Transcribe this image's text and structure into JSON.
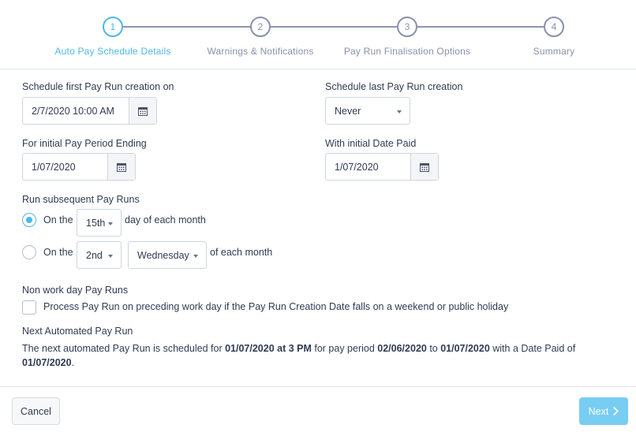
{
  "wizard": {
    "steps": [
      {
        "number": "1",
        "label": "Auto Pay Schedule Details"
      },
      {
        "number": "2",
        "label": "Warnings & Notifications"
      },
      {
        "number": "3",
        "label": "Pay Run Finalisation Options"
      },
      {
        "number": "4",
        "label": "Summary"
      }
    ],
    "active_step": 1
  },
  "form": {
    "first_creation": {
      "label": "Schedule first Pay Run creation on",
      "value": "2/7/2020 10:00 AM",
      "icon": "calendar-icon"
    },
    "last_creation": {
      "label": "Schedule last Pay Run creation",
      "value": "Never"
    },
    "initial_period_ending": {
      "label": "For initial Pay Period Ending",
      "value": "1/07/2020",
      "icon": "calendar-icon"
    },
    "initial_date_paid": {
      "label": "With initial Date Paid",
      "value": "1/07/2020",
      "icon": "calendar-icon"
    },
    "subsequent": {
      "label": "Run subsequent Pay Runs",
      "option1": {
        "prefix": "On the",
        "day": "15th",
        "suffix": "day of each month",
        "checked": true
      },
      "option2": {
        "prefix": "On the",
        "ordinal": "2nd",
        "weekday": "Wednesday",
        "suffix": "of each month",
        "checked": false
      }
    },
    "non_work_day": {
      "label": "Non work day Pay Runs",
      "checkbox_label": "Process Pay Run on preceding work day if the Pay Run Creation Date falls on a weekend or public holiday",
      "checked": false
    },
    "next_run": {
      "label": "Next Automated Pay Run",
      "text_1": "The next automated Pay Run is scheduled for ",
      "scheduled": "01/07/2020 at 3 PM",
      "text_2": " for pay period ",
      "period_start": "02/06/2020",
      "text_3": " to ",
      "period_end": "01/07/2020",
      "text_4": " with a Date Paid of ",
      "date_paid": "01/07/2020",
      "text_5": "."
    }
  },
  "footer": {
    "cancel_label": "Cancel",
    "next_label": "Next"
  },
  "colors": {
    "accent": "#4db8e8",
    "next_button": "#78cdf2",
    "step_inactive": "#8a90ad",
    "text": "#2f3b52"
  }
}
